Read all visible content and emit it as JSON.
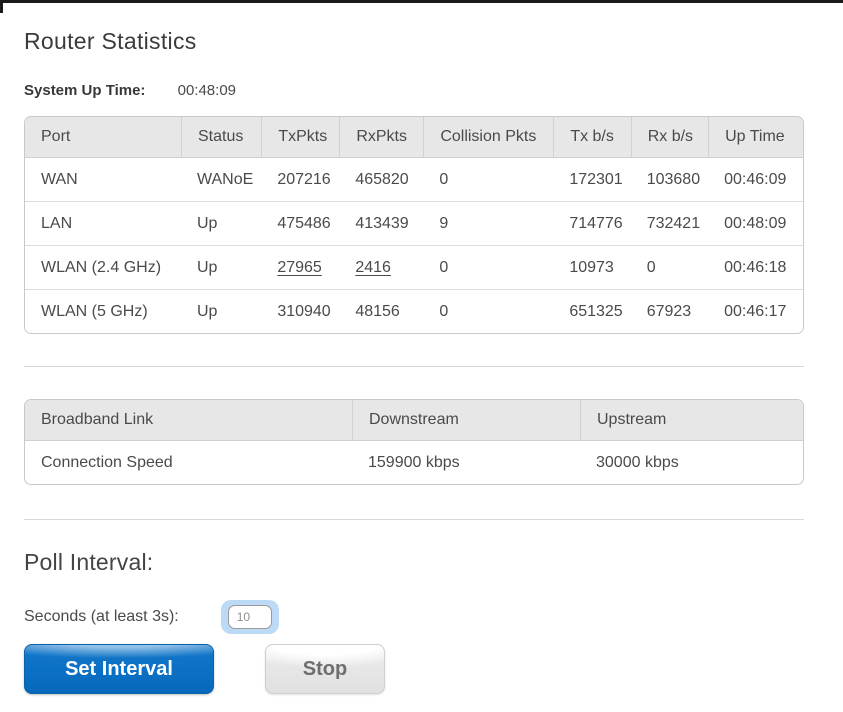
{
  "page": {
    "title": "Router Statistics",
    "system_up_time_label": "System Up Time:",
    "system_up_time_value": "00:48:09"
  },
  "port_table": {
    "headers": {
      "port": "Port",
      "status": "Status",
      "tx_pkts": "TxPkts",
      "rx_pkts": "RxPkts",
      "collision_pkts": "Collision Pkts",
      "tx_bs": "Tx b/s",
      "rx_bs": "Rx b/s",
      "up_time": "Up Time"
    },
    "rows": [
      {
        "port": "WAN",
        "status": "WANoE",
        "tx_pkts": "207216",
        "rx_pkts": "465820",
        "collision_pkts": "0",
        "tx_bs": "172301",
        "rx_bs": "103680",
        "up_time": "00:46:09"
      },
      {
        "port": "LAN",
        "status": "Up",
        "tx_pkts": "475486",
        "rx_pkts": "413439",
        "collision_pkts": "9",
        "tx_bs": "714776",
        "rx_bs": "732421",
        "up_time": "00:48:09"
      },
      {
        "port": "WLAN (2.4 GHz)",
        "status": "Up",
        "tx_pkts": "27965",
        "rx_pkts": "2416",
        "collision_pkts": "0",
        "tx_bs": "10973",
        "rx_bs": "0",
        "up_time": "00:46:18"
      },
      {
        "port": "WLAN (5 GHz)",
        "status": "Up",
        "tx_pkts": "310940",
        "rx_pkts": "48156",
        "collision_pkts": "0",
        "tx_bs": "651325",
        "rx_bs": "67923",
        "up_time": "00:46:17"
      }
    ]
  },
  "broadband_table": {
    "headers": {
      "link": "Broadband Link",
      "downstream": "Downstream",
      "upstream": "Upstream"
    },
    "rows": [
      {
        "link": "Connection Speed",
        "downstream": "159900 kbps",
        "upstream": "30000 kbps"
      }
    ]
  },
  "poll": {
    "heading": "Poll Interval:",
    "seconds_label": "Seconds (at least 3s):",
    "interval_value": "10",
    "set_interval_label": "Set Interval",
    "stop_label": "Stop"
  },
  "colors": {
    "accent_blue": "#0b70c4",
    "focus_glow": "#bcd9f6",
    "header_bg": "#e7e7e7",
    "text": "#4a4a4a",
    "window_border": "#1a1a1a"
  }
}
